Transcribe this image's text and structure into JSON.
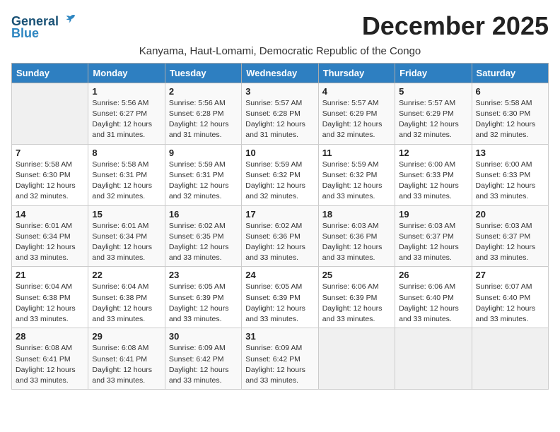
{
  "logo": {
    "line1": "General",
    "line2": "Blue"
  },
  "title": "December 2025",
  "subtitle": "Kanyama, Haut-Lomami, Democratic Republic of the Congo",
  "days_of_week": [
    "Sunday",
    "Monday",
    "Tuesday",
    "Wednesday",
    "Thursday",
    "Friday",
    "Saturday"
  ],
  "weeks": [
    [
      {
        "day": "",
        "info": ""
      },
      {
        "day": "1",
        "info": "Sunrise: 5:56 AM\nSunset: 6:27 PM\nDaylight: 12 hours\nand 31 minutes."
      },
      {
        "day": "2",
        "info": "Sunrise: 5:56 AM\nSunset: 6:28 PM\nDaylight: 12 hours\nand 31 minutes."
      },
      {
        "day": "3",
        "info": "Sunrise: 5:57 AM\nSunset: 6:28 PM\nDaylight: 12 hours\nand 31 minutes."
      },
      {
        "day": "4",
        "info": "Sunrise: 5:57 AM\nSunset: 6:29 PM\nDaylight: 12 hours\nand 32 minutes."
      },
      {
        "day": "5",
        "info": "Sunrise: 5:57 AM\nSunset: 6:29 PM\nDaylight: 12 hours\nand 32 minutes."
      },
      {
        "day": "6",
        "info": "Sunrise: 5:58 AM\nSunset: 6:30 PM\nDaylight: 12 hours\nand 32 minutes."
      }
    ],
    [
      {
        "day": "7",
        "info": "Sunrise: 5:58 AM\nSunset: 6:30 PM\nDaylight: 12 hours\nand 32 minutes."
      },
      {
        "day": "8",
        "info": "Sunrise: 5:58 AM\nSunset: 6:31 PM\nDaylight: 12 hours\nand 32 minutes."
      },
      {
        "day": "9",
        "info": "Sunrise: 5:59 AM\nSunset: 6:31 PM\nDaylight: 12 hours\nand 32 minutes."
      },
      {
        "day": "10",
        "info": "Sunrise: 5:59 AM\nSunset: 6:32 PM\nDaylight: 12 hours\nand 32 minutes."
      },
      {
        "day": "11",
        "info": "Sunrise: 5:59 AM\nSunset: 6:32 PM\nDaylight: 12 hours\nand 33 minutes."
      },
      {
        "day": "12",
        "info": "Sunrise: 6:00 AM\nSunset: 6:33 PM\nDaylight: 12 hours\nand 33 minutes."
      },
      {
        "day": "13",
        "info": "Sunrise: 6:00 AM\nSunset: 6:33 PM\nDaylight: 12 hours\nand 33 minutes."
      }
    ],
    [
      {
        "day": "14",
        "info": "Sunrise: 6:01 AM\nSunset: 6:34 PM\nDaylight: 12 hours\nand 33 minutes."
      },
      {
        "day": "15",
        "info": "Sunrise: 6:01 AM\nSunset: 6:34 PM\nDaylight: 12 hours\nand 33 minutes."
      },
      {
        "day": "16",
        "info": "Sunrise: 6:02 AM\nSunset: 6:35 PM\nDaylight: 12 hours\nand 33 minutes."
      },
      {
        "day": "17",
        "info": "Sunrise: 6:02 AM\nSunset: 6:36 PM\nDaylight: 12 hours\nand 33 minutes."
      },
      {
        "day": "18",
        "info": "Sunrise: 6:03 AM\nSunset: 6:36 PM\nDaylight: 12 hours\nand 33 minutes."
      },
      {
        "day": "19",
        "info": "Sunrise: 6:03 AM\nSunset: 6:37 PM\nDaylight: 12 hours\nand 33 minutes."
      },
      {
        "day": "20",
        "info": "Sunrise: 6:03 AM\nSunset: 6:37 PM\nDaylight: 12 hours\nand 33 minutes."
      }
    ],
    [
      {
        "day": "21",
        "info": "Sunrise: 6:04 AM\nSunset: 6:38 PM\nDaylight: 12 hours\nand 33 minutes."
      },
      {
        "day": "22",
        "info": "Sunrise: 6:04 AM\nSunset: 6:38 PM\nDaylight: 12 hours\nand 33 minutes."
      },
      {
        "day": "23",
        "info": "Sunrise: 6:05 AM\nSunset: 6:39 PM\nDaylight: 12 hours\nand 33 minutes."
      },
      {
        "day": "24",
        "info": "Sunrise: 6:05 AM\nSunset: 6:39 PM\nDaylight: 12 hours\nand 33 minutes."
      },
      {
        "day": "25",
        "info": "Sunrise: 6:06 AM\nSunset: 6:39 PM\nDaylight: 12 hours\nand 33 minutes."
      },
      {
        "day": "26",
        "info": "Sunrise: 6:06 AM\nSunset: 6:40 PM\nDaylight: 12 hours\nand 33 minutes."
      },
      {
        "day": "27",
        "info": "Sunrise: 6:07 AM\nSunset: 6:40 PM\nDaylight: 12 hours\nand 33 minutes."
      }
    ],
    [
      {
        "day": "28",
        "info": "Sunrise: 6:08 AM\nSunset: 6:41 PM\nDaylight: 12 hours\nand 33 minutes."
      },
      {
        "day": "29",
        "info": "Sunrise: 6:08 AM\nSunset: 6:41 PM\nDaylight: 12 hours\nand 33 minutes."
      },
      {
        "day": "30",
        "info": "Sunrise: 6:09 AM\nSunset: 6:42 PM\nDaylight: 12 hours\nand 33 minutes."
      },
      {
        "day": "31",
        "info": "Sunrise: 6:09 AM\nSunset: 6:42 PM\nDaylight: 12 hours\nand 33 minutes."
      },
      {
        "day": "",
        "info": ""
      },
      {
        "day": "",
        "info": ""
      },
      {
        "day": "",
        "info": ""
      }
    ]
  ]
}
